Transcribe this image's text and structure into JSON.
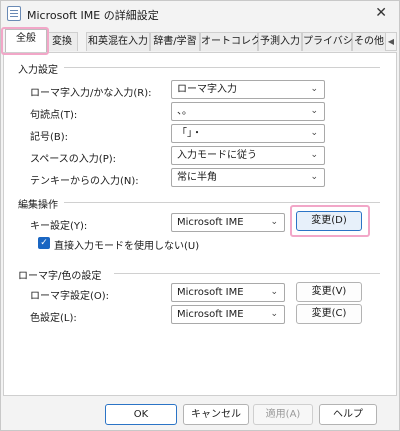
{
  "window": {
    "title": "Microsoft IME の詳細設定",
    "icon": "ime-settings-icon",
    "close_glyph": "✕"
  },
  "tabs": [
    {
      "label": "全般",
      "active": true
    },
    {
      "label": "変換"
    },
    {
      "label": "和英混在入力"
    },
    {
      "label": "辞書/学習"
    },
    {
      "label": "オートコレクト"
    },
    {
      "label": "予測入力"
    },
    {
      "label": "プライバシー"
    },
    {
      "label": "その他"
    }
  ],
  "input_settings": {
    "title": "入力設定",
    "rows": [
      {
        "label": "ローマ字入力/かな入力(R):",
        "value": "ローマ字入力"
      },
      {
        "label": "句読点(T):",
        "value": "、。"
      },
      {
        "label": "記号(B):",
        "value": "「」・"
      },
      {
        "label": "スペースの入力(P):",
        "value": "入力モードに従う"
      },
      {
        "label": "テンキーからの入力(N):",
        "value": "常に半角"
      }
    ]
  },
  "edit_ops": {
    "title": "編集操作",
    "key_label": "キー設定(Y):",
    "key_value": "Microsoft IME",
    "change_button": "変更(D)",
    "checkbox_label": "直接入力モードを使用しない(U)",
    "checkbox_checked": true
  },
  "romaji_color": {
    "title": "ローマ字/色の設定",
    "romaji_label": "ローマ字設定(O):",
    "romaji_value": "Microsoft IME",
    "romaji_button": "変更(V)",
    "color_label": "色設定(L):",
    "color_value": "Microsoft IME",
    "color_button": "変更(C)"
  },
  "footer": {
    "ok": "OK",
    "cancel": "キャンセル",
    "apply": "適用(A)",
    "help": "ヘルプ"
  },
  "colors": {
    "highlight": "#f2a7c8",
    "accent": "#2b74c6"
  }
}
